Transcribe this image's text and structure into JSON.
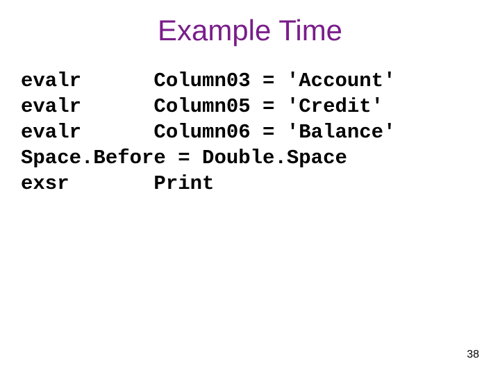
{
  "title": "Example Time",
  "code": {
    "line1": "evalr      Column03 = 'Account'",
    "line2": "evalr      Column05 = 'Credit'",
    "line3": "evalr      Column06 = 'Balance'",
    "line4": "Space.Before = Double.Space",
    "line5": "exsr       Print"
  },
  "pageNumber": "38"
}
